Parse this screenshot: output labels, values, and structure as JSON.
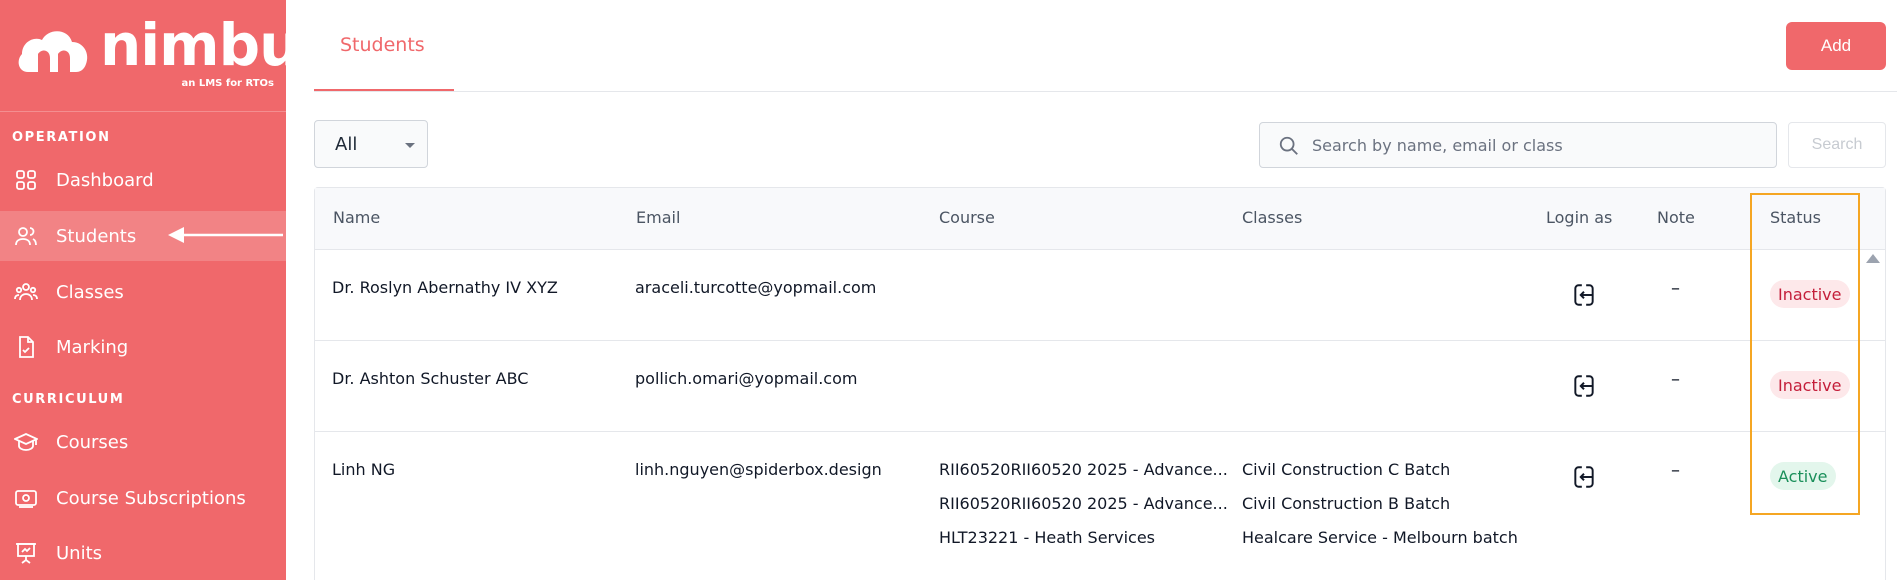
{
  "sidebar": {
    "logo_word": "nimbu",
    "logo_tagline": "an LMS for RTOs",
    "sections": [
      {
        "title": "OPERATION"
      },
      {
        "title": "CURRICULUM"
      }
    ],
    "items": [
      {
        "label": "Dashboard",
        "icon": "grid-icon"
      },
      {
        "label": "Students",
        "icon": "users-icon",
        "active": true
      },
      {
        "label": "Classes",
        "icon": "group-icon"
      },
      {
        "label": "Marking",
        "icon": "file-check-icon"
      },
      {
        "label": "Courses",
        "icon": "graduation-cap-icon"
      },
      {
        "label": "Course Subscriptions",
        "icon": "subscription-icon"
      },
      {
        "label": "Units",
        "icon": "presentation-icon"
      }
    ]
  },
  "header": {
    "tab_label": "Students",
    "add_label": "Add"
  },
  "filters": {
    "status_selected": "All",
    "search_placeholder": "Search by name, email or class",
    "search_button": "Search"
  },
  "table": {
    "columns": [
      "Name",
      "Email",
      "Course",
      "Classes",
      "Login as",
      "Note",
      "Status"
    ],
    "rows": [
      {
        "name": "Dr. Roslyn Abernathy IV XYZ",
        "email": "araceli.turcotte@yopmail.com",
        "courses": [],
        "classes": [],
        "note": "–",
        "status": "Inactive"
      },
      {
        "name": "Dr. Ashton Schuster ABC",
        "email": "pollich.omari@yopmail.com",
        "courses": [],
        "classes": [],
        "note": "–",
        "status": "Inactive"
      },
      {
        "name": "Linh NG",
        "email": "linh.nguyen@spiderbox.design",
        "courses": [
          "RII60520RII60520 2025 - Advance...",
          "RII60520RII60520 2025 - Advance...",
          "HLT23221 - Heath Services"
        ],
        "classes": [
          "Civil Construction C Batch",
          "Civil Construction B Batch",
          "Healcare Service - Melbourn batch"
        ],
        "note": "–",
        "status": "Active"
      }
    ]
  },
  "colors": {
    "brand": "#f0686b",
    "highlight": "#f5a623",
    "inactive": "#c41e3a",
    "active": "#1a8f5a"
  }
}
